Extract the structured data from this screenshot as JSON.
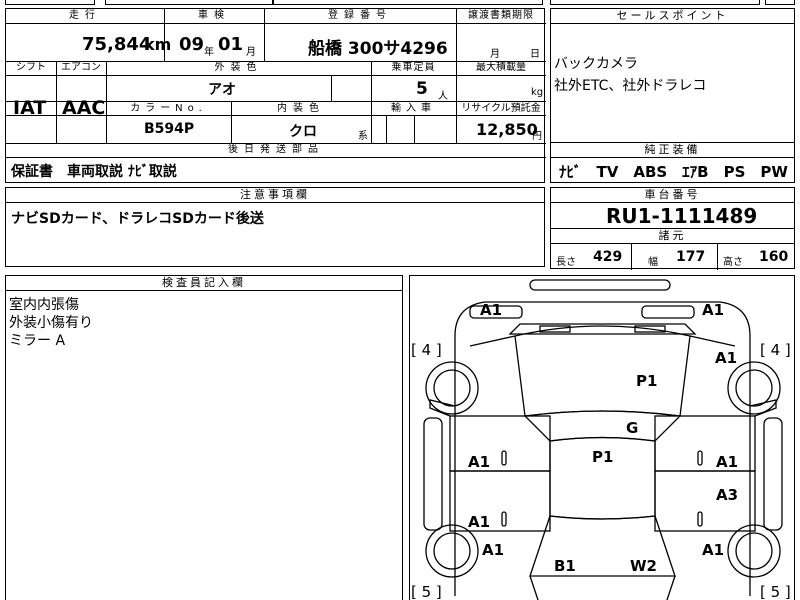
{
  "top_strip": {
    "left_partial": "",
    "mid_partial": "",
    "right_partial": ""
  },
  "grid": {
    "mileage_label": "走行",
    "mileage_value": "75,844",
    "mileage_unit": "km",
    "inspection_label": "車検",
    "inspection_year": "09",
    "inspection_year_unit": "年",
    "inspection_month": "01",
    "inspection_month_unit": "月",
    "plate_label": "登録番号",
    "plate_value": "船橋 300サ4296",
    "transfer_label": "譲渡書類期限",
    "transfer_month_unit": "月",
    "transfer_day_unit": "日",
    "shift_label": "シフト",
    "aircon_label": "エアコン",
    "ext_color_label": "外装色",
    "ext_color_value": "アオ",
    "capacity_label": "乗車定員",
    "capacity_value": "5",
    "capacity_unit": "人",
    "max_load_label": "最大積載量",
    "max_load_unit": "kg",
    "shift_value": "IAT",
    "aircon_value": "AAC",
    "color_no_label": "カラーNo.",
    "color_no_value": "B594P",
    "int_color_label": "内装色",
    "int_color_value": "クロ",
    "int_color_suffix": "系",
    "import_label": "輸入車",
    "recycle_label": "リサイクル預託金",
    "recycle_value": "12,850",
    "recycle_unit": "円",
    "later_parts_label": "後日発送部品",
    "later_parts_value": "保証書　車両取説 ﾅﾋﾞ取説",
    "notes_label": "注意事項欄",
    "notes_value": "ナビSDカード、ドラレコSDカード後送"
  },
  "sales_point": {
    "label": "セールスポイント",
    "line1": "バックカメラ",
    "line2": "社外ETC、社外ドラレコ"
  },
  "equipment": {
    "label": "純正装備",
    "value": "ﾅﾋﾞ　TV　ABS　ｴｱB　PS　PW"
  },
  "chassis": {
    "label": "車台番号",
    "value": "RU1-1111489"
  },
  "dimensions": {
    "label": "諸元",
    "length_label": "長さ",
    "length_value": "429",
    "width_label": "幅",
    "width_value": "177",
    "height_label": "高さ",
    "height_value": "160"
  },
  "inspector": {
    "label": "検査員記入欄",
    "line1": "室内内張傷",
    "line2": "外装小傷有り",
    "line3": "ミラー A"
  },
  "diagram": {
    "marks": {
      "front_left": "A1",
      "front_right": "A1",
      "fender_right": "A1",
      "hood": "P1",
      "windshield": "G",
      "roof": "P1",
      "front_door_left": "A1",
      "front_door_right": "A1",
      "rear_door_left": "A1",
      "rear_door_right": "A3",
      "rear_fender_left": "A1",
      "rear_fender_right": "A1",
      "rear_left": "B1",
      "rear_right": "W2"
    },
    "tire_front_left": "[ 4 ]",
    "tire_front_right": "[ 4 ]",
    "tire_rear_left": "[ 5 ]",
    "tire_rear_right": "[ 5 ]"
  }
}
